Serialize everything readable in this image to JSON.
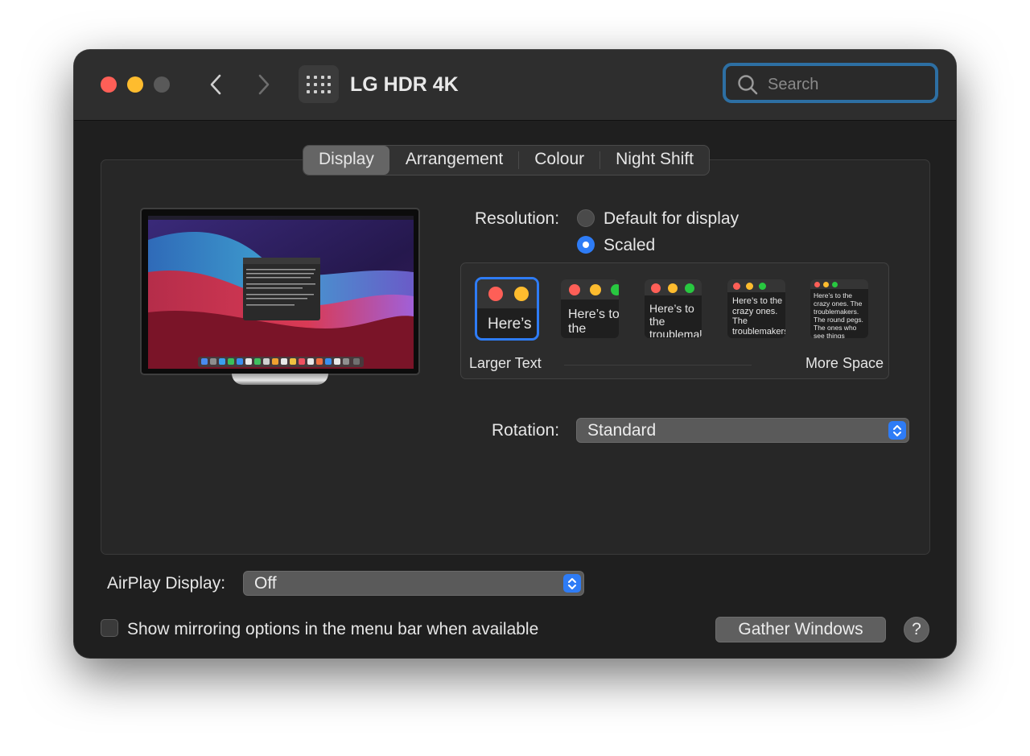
{
  "window": {
    "title": "LG HDR 4K",
    "nav": {
      "back_icon": "chevron-left-icon",
      "forward_icon": "chevron-right-icon",
      "grid_icon": "grid-icon"
    },
    "search": {
      "placeholder": "Search",
      "value": ""
    }
  },
  "tabs": [
    {
      "label": "Display",
      "active": true
    },
    {
      "label": "Arrangement",
      "active": false
    },
    {
      "label": "Colour",
      "active": false
    },
    {
      "label": "Night Shift",
      "active": false
    }
  ],
  "resolution": {
    "label": "Resolution:",
    "options": [
      {
        "label": "Default for display",
        "selected": false
      },
      {
        "label": "Scaled",
        "selected": true
      }
    ],
    "scale_options": [
      {
        "preview_text": "Here’s",
        "selected": true
      },
      {
        "preview_text": "Here’s to the troublemakers",
        "selected": false
      },
      {
        "preview_text": "Here’s to the troublemakers. The ones who",
        "selected": false
      },
      {
        "preview_text": "Here’s to the crazy ones. The troublemakers. The ones who see things differently. They’re not fond of rules. And they have no",
        "selected": false
      },
      {
        "preview_text": "Here’s to the crazy ones. The troublemakers. The round pegs. The ones who see things differently. They’re not fond of rules. And they have no respect. You can quote them, disagree with them. About the only thing. Because they change things.",
        "selected": false
      }
    ],
    "larger_text_label": "Larger Text",
    "more_space_label": "More Space"
  },
  "rotation": {
    "label": "Rotation:",
    "value": "Standard"
  },
  "airplay": {
    "label": "AirPlay Display:",
    "value": "Off"
  },
  "mirroring": {
    "label": "Show mirroring options in the menu bar when available",
    "checked": false
  },
  "buttons": {
    "gather_windows": "Gather Windows",
    "help": "?"
  },
  "colors": {
    "accent": "#2e7cf6",
    "close": "#fe5f57",
    "minimize": "#febc2e",
    "search_ring": "#2d6fa3"
  }
}
